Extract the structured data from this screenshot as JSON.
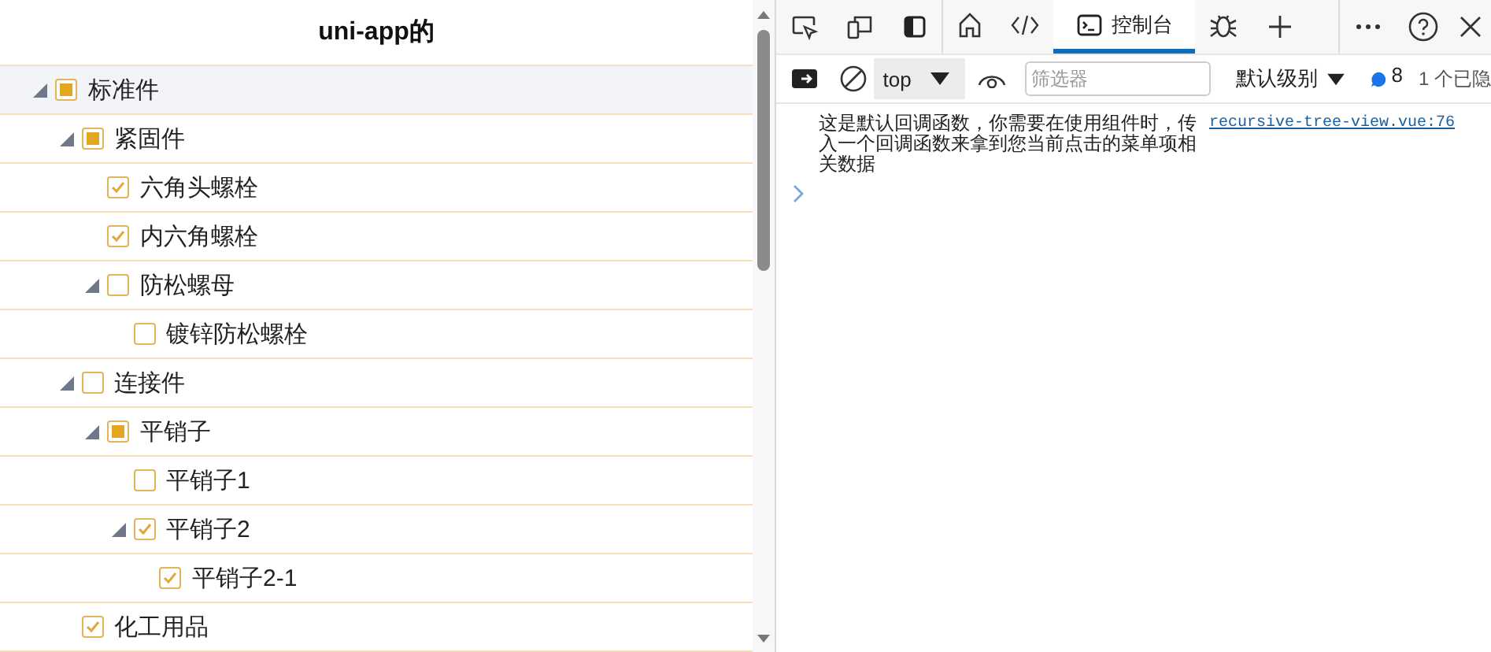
{
  "tree_panel": {
    "title": "uni-app的",
    "items": [
      {
        "label": "标准件",
        "checked": false,
        "indeterminate": true,
        "expanded": true,
        "selected": true,
        "children": [
          {
            "label": "紧固件",
            "checked": false,
            "indeterminate": true,
            "expanded": true,
            "selected": false,
            "children": [
              {
                "label": "六角头螺栓",
                "checked": true,
                "indeterminate": false,
                "selected": false
              },
              {
                "label": "内六角螺栓",
                "checked": true,
                "indeterminate": false,
                "selected": false
              },
              {
                "label": "防松螺母",
                "checked": false,
                "indeterminate": false,
                "expanded": true,
                "selected": false,
                "children": [
                  {
                    "label": "镀锌防松螺栓",
                    "checked": false,
                    "indeterminate": false,
                    "selected": false
                  }
                ]
              }
            ]
          },
          {
            "label": "连接件",
            "checked": false,
            "indeterminate": false,
            "expanded": true,
            "selected": false,
            "children": [
              {
                "label": "平销子",
                "checked": false,
                "indeterminate": true,
                "expanded": true,
                "selected": false,
                "children": [
                  {
                    "label": "平销子1",
                    "checked": false,
                    "indeterminate": false,
                    "selected": false
                  },
                  {
                    "label": "平销子2",
                    "checked": true,
                    "indeterminate": false,
                    "expanded": true,
                    "selected": false,
                    "children": [
                      {
                        "label": "平销子2-1",
                        "checked": true,
                        "indeterminate": false,
                        "selected": false
                      }
                    ]
                  }
                ]
              }
            ]
          },
          {
            "label": "化工用品",
            "checked": true,
            "indeterminate": false,
            "selected": false
          }
        ]
      }
    ]
  },
  "devtools": {
    "tabs": [
      {
        "kind": "welcome",
        "selected": false
      },
      {
        "kind": "elements",
        "selected": false
      },
      {
        "kind": "console",
        "label": "控制台",
        "selected": true
      },
      {
        "kind": "sources",
        "selected": false
      }
    ],
    "console_toolbar": {
      "context": "top",
      "filter": {
        "placeholder": "筛选器"
      },
      "level": "默认级别",
      "message_count": "8",
      "hidden_count": "1 个已隐"
    },
    "messages": [
      {
        "text": "这是默认回调函数，你需要在使用组件时，传入一个回调函数来拿到您当前点击的菜单项相关数据",
        "source": "recursive-tree-view.vue:76"
      }
    ]
  }
}
